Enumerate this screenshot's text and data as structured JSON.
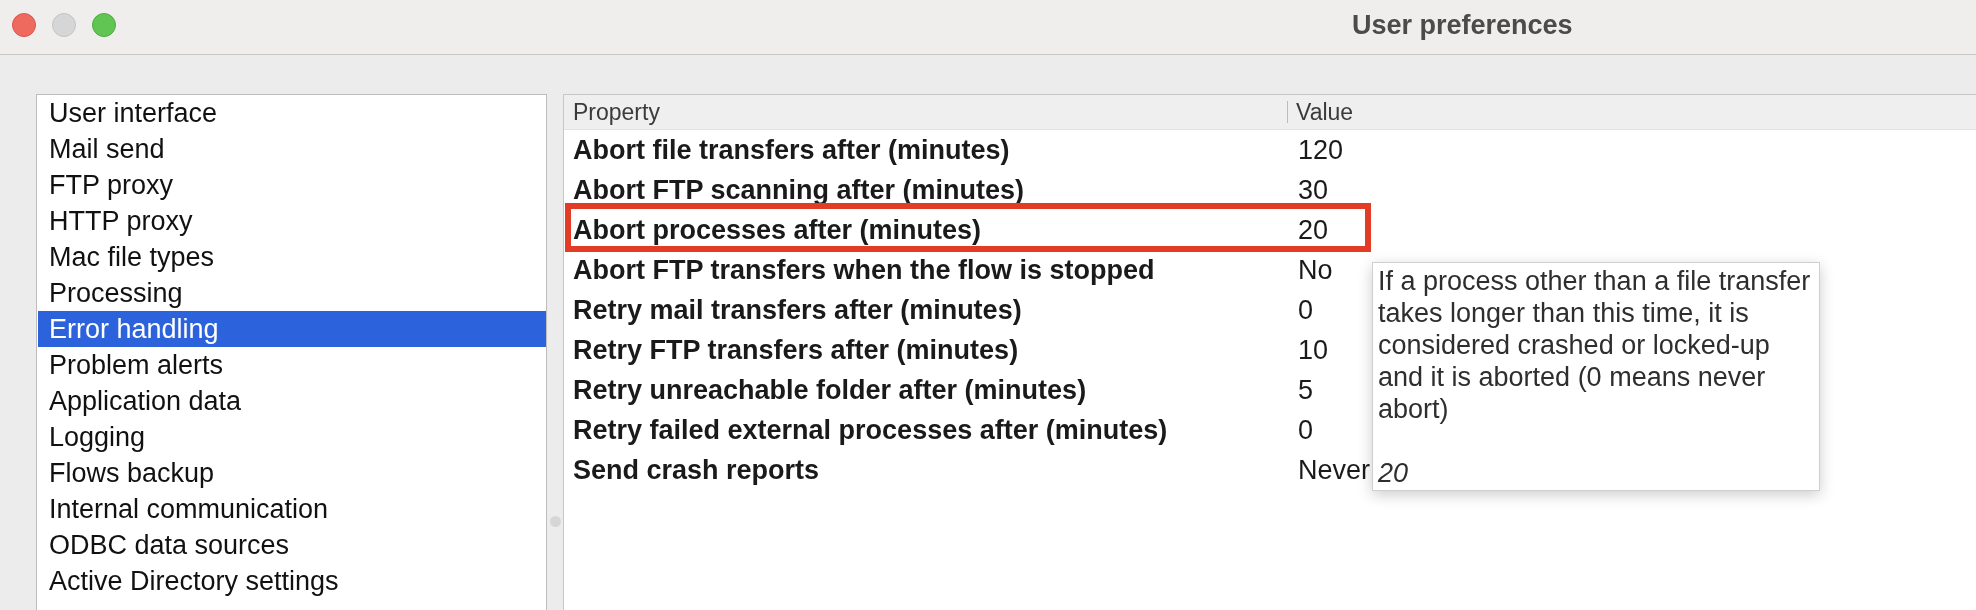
{
  "window": {
    "title": "User preferences",
    "controls": [
      {
        "kind": "close",
        "disabled": false
      },
      {
        "kind": "minimize",
        "disabled": true
      },
      {
        "kind": "zoom",
        "disabled": false
      }
    ]
  },
  "sidebar": {
    "items": [
      {
        "label": "User interface",
        "selected": false
      },
      {
        "label": "Mail send",
        "selected": false
      },
      {
        "label": "FTP proxy",
        "selected": false
      },
      {
        "label": "HTTP proxy",
        "selected": false
      },
      {
        "label": "Mac file types",
        "selected": false
      },
      {
        "label": "Processing",
        "selected": false
      },
      {
        "label": "Error handling",
        "selected": true
      },
      {
        "label": "Problem alerts",
        "selected": false
      },
      {
        "label": "Application data",
        "selected": false
      },
      {
        "label": "Logging",
        "selected": false
      },
      {
        "label": "Flows backup",
        "selected": false
      },
      {
        "label": "Internal communication",
        "selected": false
      },
      {
        "label": "ODBC data sources",
        "selected": false
      },
      {
        "label": "Active Directory settings",
        "selected": false
      }
    ]
  },
  "table": {
    "columns": [
      "Property",
      "Value"
    ],
    "rows": [
      {
        "property": "Abort file transfers after (minutes)",
        "value": "120",
        "highlighted": false
      },
      {
        "property": "Abort FTP scanning after (minutes)",
        "value": "30",
        "highlighted": false
      },
      {
        "property": "Abort processes after (minutes)",
        "value": "20",
        "highlighted": true
      },
      {
        "property": "Abort FTP transfers when the flow is stopped",
        "value": "No",
        "highlighted": false
      },
      {
        "property": "Retry mail transfers after (minutes)",
        "value": "0",
        "highlighted": false
      },
      {
        "property": "Retry FTP transfers after (minutes)",
        "value": "10",
        "highlighted": false
      },
      {
        "property": "Retry unreachable folder after (minutes)",
        "value": "5",
        "highlighted": false
      },
      {
        "property": "Retry failed external processes after (minutes)",
        "value": "0",
        "highlighted": false
      },
      {
        "property": "Send crash reports",
        "value": "Never",
        "highlighted": false
      }
    ]
  },
  "tooltip": {
    "description": "If a process other than a file transfer takes longer than this time, it is considered crashed or locked-up and it is aborted (0 means never abort)",
    "value": "20"
  }
}
